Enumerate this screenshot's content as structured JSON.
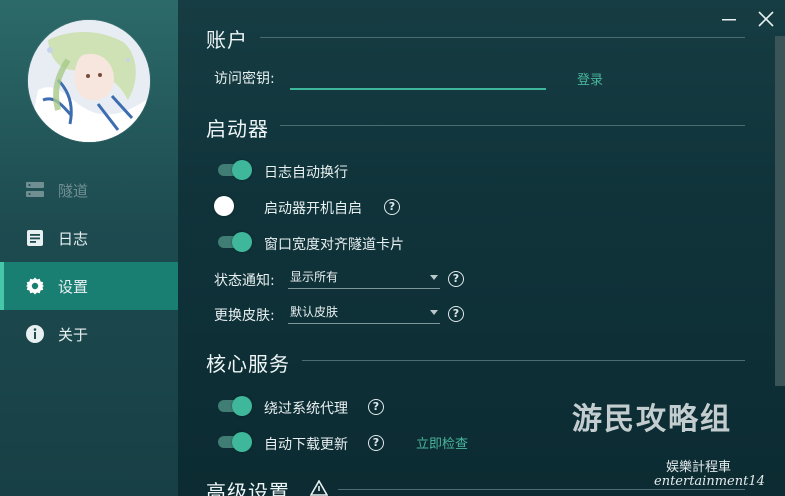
{
  "window": {
    "minimize_icon": "minimize-icon",
    "close_icon": "close-icon"
  },
  "sidebar": {
    "items": [
      {
        "label": "隧道",
        "icon": "server-icon",
        "state": "disabled"
      },
      {
        "label": "日志",
        "icon": "log-icon",
        "state": "normal"
      },
      {
        "label": "设置",
        "icon": "gear-icon",
        "state": "active"
      },
      {
        "label": "关于",
        "icon": "info-icon",
        "state": "normal"
      }
    ]
  },
  "account": {
    "title": "账户",
    "key_label": "访问密钥:",
    "key_value": "",
    "login_label": "登录"
  },
  "launcher": {
    "title": "启动器",
    "options": [
      {
        "label": "日志自动换行",
        "on": true,
        "help": false
      },
      {
        "label": "启动器开机自启",
        "on": false,
        "help": true
      },
      {
        "label": "窗口宽度对齐隧道卡片",
        "on": true,
        "help": false
      }
    ],
    "notify_label": "状态通知:",
    "notify_value": "显示所有",
    "skin_label": "更换皮肤:",
    "skin_value": "默认皮肤"
  },
  "core": {
    "title": "核心服务",
    "options": [
      {
        "label": "绕过系统代理",
        "on": true,
        "help": true
      },
      {
        "label": "自动下载更新",
        "on": true,
        "help": true
      }
    ],
    "check_now_label": "立即检查"
  },
  "advanced": {
    "title": "高级设置",
    "warning_icon": "warning-icon"
  },
  "watermark": {
    "line1": "游民攻略组",
    "line2": "娱樂計程車",
    "line3": "entertainment14"
  },
  "colors": {
    "accent": "#3fb79b",
    "active_nav": "#1a7f73",
    "bg": "#10333a"
  }
}
